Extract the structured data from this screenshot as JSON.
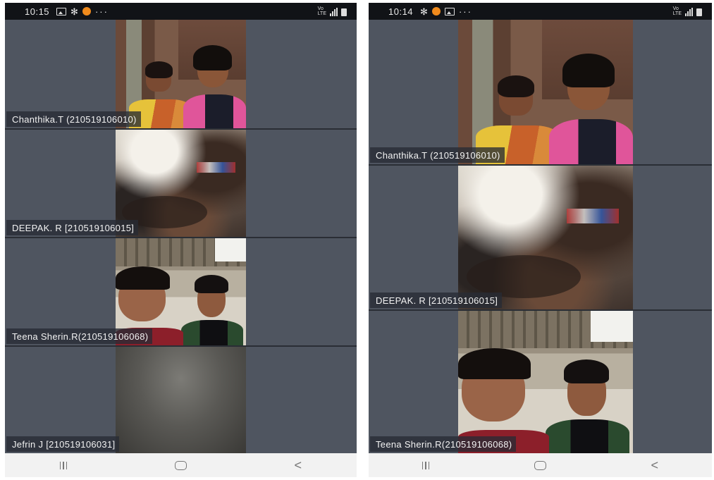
{
  "screens": [
    {
      "status": {
        "time": "10:15"
      },
      "participants": [
        {
          "name": "Chanthika.T (210519106010)"
        },
        {
          "name": "DEEPAK. R [210519106015]"
        },
        {
          "name": "Teena Sherin.R(210519106068)"
        },
        {
          "name": "Jefrin J [210519106031]"
        }
      ]
    },
    {
      "status": {
        "time": "10:14"
      },
      "participants": [
        {
          "name": "Chanthika.T (210519106010)"
        },
        {
          "name": "DEEPAK. R [210519106015]"
        },
        {
          "name": "Teena Sherin.R(210519106068)"
        }
      ]
    }
  ],
  "icons": {
    "status": [
      "gallery-icon",
      "fan-icon",
      "notification-dot-icon",
      "more-dots-icon",
      "lte-icon",
      "signal-icon",
      "battery-icon"
    ],
    "nav": [
      "recent-apps-icon",
      "home-icon",
      "back-icon"
    ]
  },
  "colors": {
    "tile_bg": "#4f5560",
    "status_bar": "#111317",
    "name_tag_bg": "#282c34",
    "nav_bar": "#f2f2f2",
    "notification_dot": "#f08a1c"
  }
}
